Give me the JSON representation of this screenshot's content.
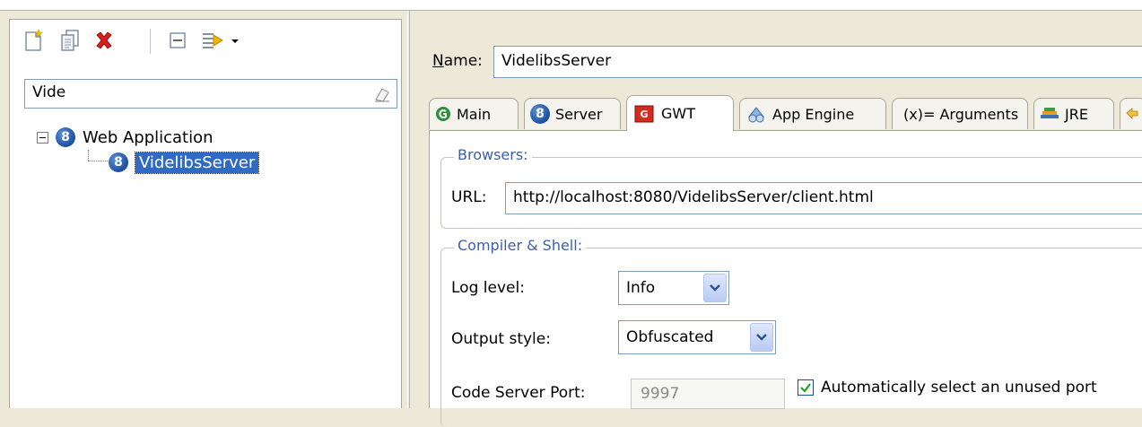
{
  "left": {
    "toolbar": {
      "new_icon": "new-launch-config-icon",
      "duplicate_icon": "duplicate-icon",
      "delete_icon": "delete-icon",
      "collapse_icon": "collapse-all-icon",
      "filter_icon": "filter-icon"
    },
    "filter_value": "Vide",
    "tree": {
      "parent_label": "Web Application",
      "child_label": "VidelibsServer"
    }
  },
  "right": {
    "name_label_accel": "N",
    "name_label_rest": "ame:",
    "name_value": "VidelibsServer",
    "tabs": [
      {
        "label": "Main",
        "icon": "main-tab-icon"
      },
      {
        "label": "Server",
        "icon": "server-tab-icon"
      },
      {
        "label": "GWT",
        "icon": "gwt-tab-icon"
      },
      {
        "label": "App Engine",
        "icon": "app-engine-tab-icon"
      },
      {
        "label": "(x)= Arguments",
        "icon": "arguments-tab-icon"
      },
      {
        "label": "JRE",
        "icon": "jre-tab-icon"
      }
    ],
    "active_tab": "GWT",
    "browsers": {
      "title": "Browsers:",
      "url_label": "URL:",
      "url_value": "http://localhost:8080/VidelibsServer/client.html"
    },
    "compiler": {
      "title": "Compiler & Shell:",
      "log_level_label": "Log level:",
      "log_level_value": "Info",
      "output_style_label": "Output style:",
      "output_style_value": "Obfuscated",
      "port_label": "Code Server Port:",
      "port_value": "9997",
      "auto_port_label": "Automatically select an unused port",
      "auto_port_checked": true
    }
  },
  "colors": {
    "selection": "#316ac5",
    "group_title": "#3c5fa8",
    "background": "#ece9d8"
  }
}
